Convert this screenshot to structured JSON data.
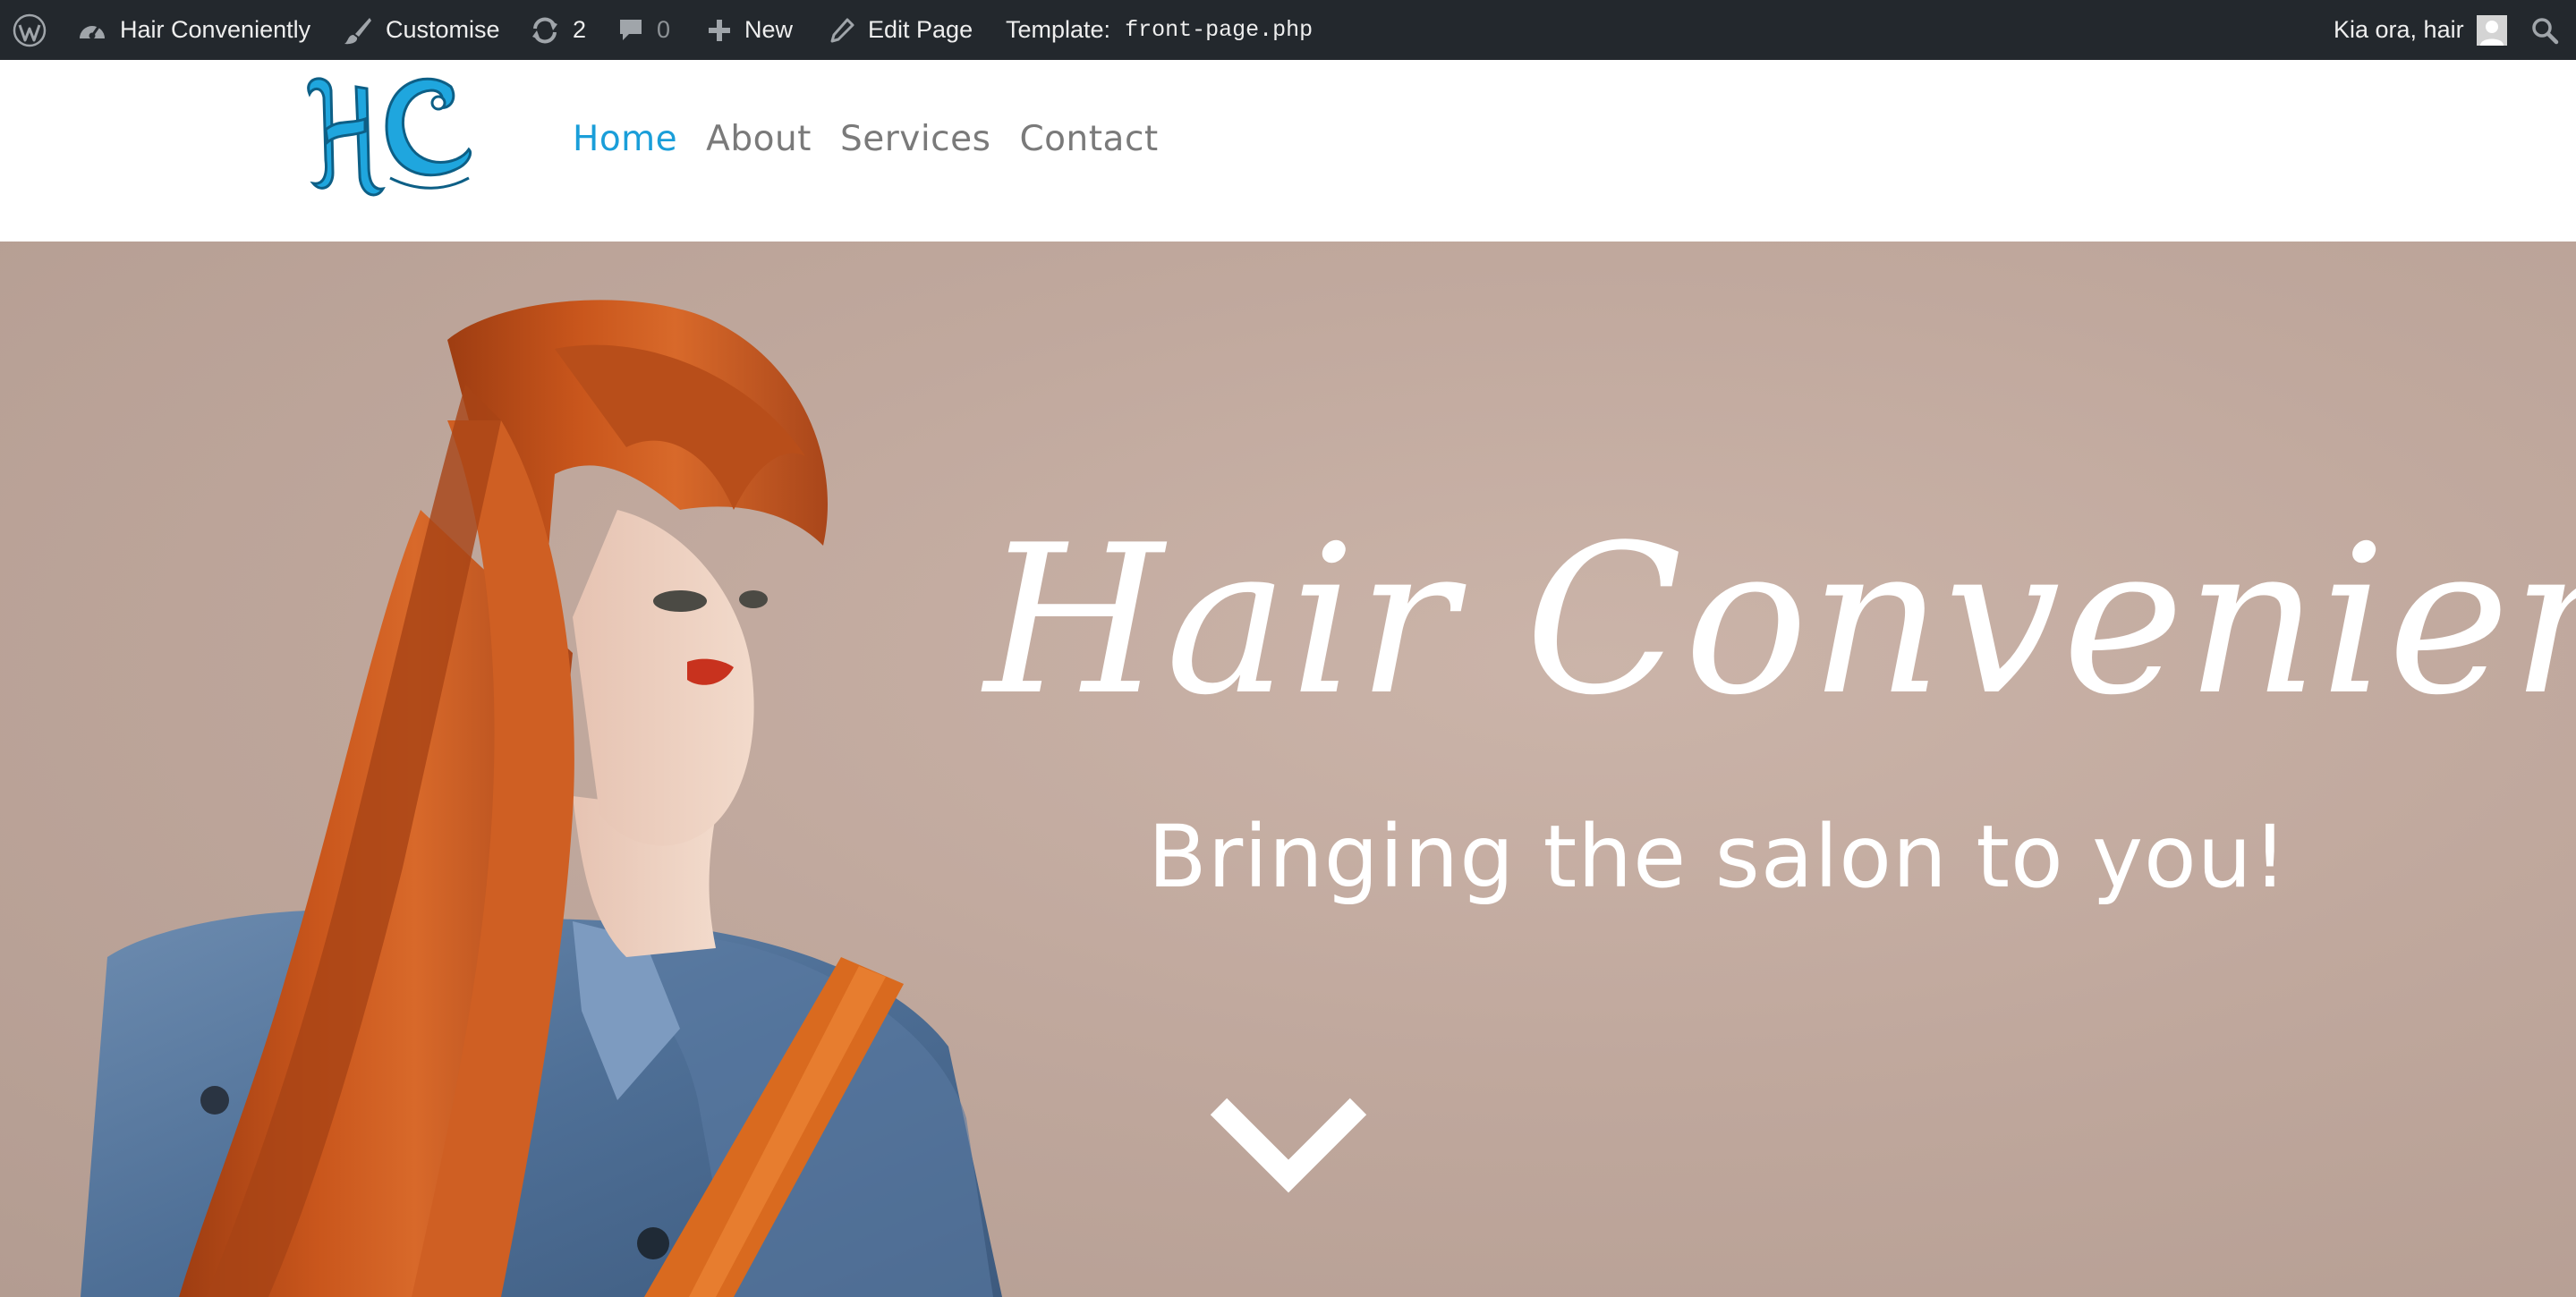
{
  "adminbar": {
    "wp_logo_icon": "wordpress-logo-icon",
    "site_name": "Hair Conveniently",
    "site_icon": "dashboard-icon",
    "customise_label": "Customise",
    "customise_icon": "paintbrush-icon",
    "updates_count": "2",
    "updates_icon": "refresh-icon",
    "comments_count": "0",
    "comments_icon": "comment-bubble-icon",
    "new_label": "New",
    "new_icon": "plus-icon",
    "edit_page_label": "Edit Page",
    "edit_page_icon": "pencil-icon",
    "template_label": "Template:",
    "template_file": "front-page.php",
    "greeting": "Kia ora, hair",
    "avatar_icon": "user-avatar-icon",
    "search_icon": "search-icon",
    "colors": {
      "background": "#23282d",
      "text": "#eeeeee",
      "muted": "#8d9296"
    }
  },
  "header": {
    "logo_alt": "HC",
    "logo_color": "#1fa6de",
    "nav": [
      {
        "label": "Home",
        "active": true
      },
      {
        "label": "About",
        "active": false
      },
      {
        "label": "Services",
        "active": false
      },
      {
        "label": "Contact",
        "active": false
      }
    ],
    "colors": {
      "nav_active": "#1a9ed9",
      "nav_default": "#7a7a7a"
    }
  },
  "hero": {
    "title": "Hair Conveniently",
    "subtitle": "Bringing the salon to you!",
    "scroll_icon": "chevron-down-icon",
    "background_color": "#c4ada2",
    "image_subject": "model-photo"
  }
}
